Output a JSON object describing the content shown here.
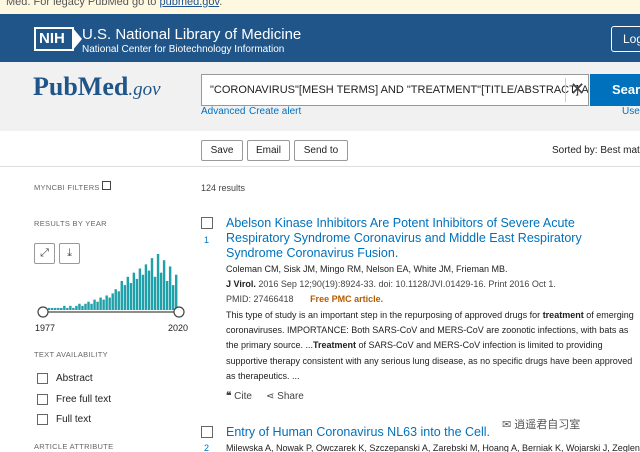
{
  "banner": {
    "text": "Med. For legacy PubMed go to ",
    "link": "pubmed.gov",
    "suffix": "."
  },
  "header": {
    "logo_text": "NIH",
    "title": "U.S. National Library of Medicine",
    "subtitle": "National Center for Biotechnology Information",
    "login_label": "Log"
  },
  "search": {
    "logo_main": "PubMed",
    "logo_suffix": ".gov",
    "query": "\"CORONAVIRUS\"[MESH TERMS] AND \"TREATMENT\"[TITLE/ABSTRACT] AND (",
    "clear_icon": "close-icon",
    "button_label": "Search",
    "advanced_label": "Advanced",
    "create_alert_label": "Create alert",
    "user_guide_label": "User"
  },
  "actions": {
    "save_label": "Save",
    "email_label": "Email",
    "send_to_label": "Send to",
    "sorted_by": "Sorted by: Best match"
  },
  "sidebar": {
    "myncbi_filters": "MYNCBI FILTERS",
    "results_by_year": "RESULTS BY YEAR",
    "year_start": "1977",
    "year_end": "2020",
    "text_availability": "TEXT AVAILABILITY",
    "filters": [
      {
        "label": "Abstract"
      },
      {
        "label": "Free full text"
      },
      {
        "label": "Full text"
      }
    ],
    "article_attribute": "ARTICLE ATTRIBUTE"
  },
  "results": {
    "count": "124 results",
    "items": [
      {
        "number": "1",
        "title": "Abelson Kinase Inhibitors Are Potent Inhibitors of Severe Acute Respiratory Syndrome Coronavirus and Middle East Respiratory Syndrome Coronavirus Fusion.",
        "authors": "Coleman CM, Sisk JM, Mingo RM, Nelson EA, White JM, Frieman MB.",
        "journal": "J Virol.",
        "citation": " 2016 Sep 12;90(19):8924-33. doi: 10.1128/JVI.01429-16. Print 2016 Oct 1.",
        "pmid": "PMID: 27466418",
        "pmc": "Free PMC article.",
        "snippet_1": "This type of study is an important step in the repurposing of approved drugs for ",
        "snippet_b1": "treatment",
        "snippet_2": " of emerging coronaviruses. IMPORTANCE: Both SARS-CoV and MERS-CoV are zoonotic infections, with bats as the primary source. ...",
        "snippet_b2": "Treatment",
        "snippet_3": " of SARS-CoV and MERS-CoV infection is limited to providing supportive therapy consistent with any serious lung disease, as no specific drugs have been approved as therapeutics. ...",
        "cite_label": "Cite",
        "share_label": "Share"
      },
      {
        "number": "2",
        "title": "Entry of Human Coronavirus NL63 into the Cell.",
        "authors": "Milewska A, Nowak P, Owczarek K, Szczepanski A, Zarebski M, Hoang A, Berniak K, Wojarski J, Zeglen S,"
      }
    ]
  },
  "year_histogram": [
    1,
    1,
    1,
    1,
    1,
    2,
    1,
    2,
    1,
    2,
    3,
    2,
    3,
    4,
    3,
    5,
    4,
    6,
    5,
    7,
    6,
    8,
    10,
    9,
    14,
    12,
    16,
    13,
    18,
    15,
    20,
    17,
    22,
    19,
    25,
    16,
    27,
    18,
    24,
    14,
    21,
    12,
    17
  ],
  "watermark": "逍遥君自习室",
  "colors": {
    "header": "#20558a",
    "accent": "#0071bc",
    "histogram": "#20a0a8",
    "pmc": "#b35c00"
  }
}
